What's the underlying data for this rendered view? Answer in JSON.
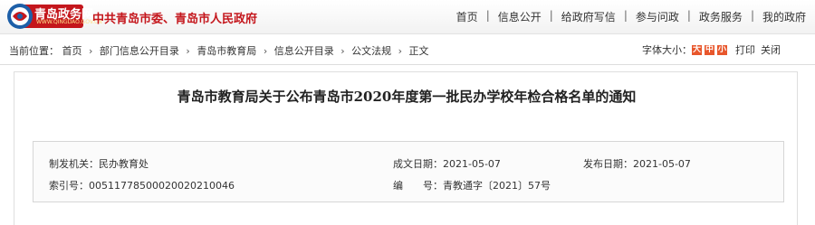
{
  "header": {
    "logo_text": "青岛政务网",
    "logo_sub": "WWW.QINGDAO.GOV.CN",
    "site_title": "中共青岛市委、青岛市人民政府",
    "nav": [
      "首页",
      "信息公开",
      "给政府写信",
      "参与问政",
      "政务服务",
      "我的政府"
    ],
    "nav_sep": "|"
  },
  "breadcrumb": {
    "prefix": "当前位置：",
    "items": [
      "首页",
      "部门信息公开目录",
      "青岛市教育局",
      "信息公开目录",
      "公文法规",
      "正文"
    ],
    "arrow": "›"
  },
  "tools": {
    "font_size_label": "字体大小：",
    "font_large": "大",
    "font_medium": "中",
    "font_small": "小",
    "print": "打印",
    "close": "关闭",
    "colors": {
      "large": "#e8572c",
      "medium": "#e8572c",
      "small": "#e8572c"
    }
  },
  "document": {
    "title": "青岛市教育局关于公布青岛市2020年度第一批民办学校年检合格名单的通知",
    "issuer_label": "制发机关：",
    "issuer": "民办教育处",
    "written_date_label": "成文日期：",
    "written_date": "2021-05-07",
    "publish_date_label": "发布日期：",
    "publish_date": "2021-05-07",
    "index_label": "索引号：",
    "index": "00511778500020020210046",
    "number_label": "编　　号：",
    "number": "青教通字〔2021〕57号"
  },
  "colors": {
    "brand_red": "#c4161c",
    "logo_blue": "#1d5fa8"
  }
}
